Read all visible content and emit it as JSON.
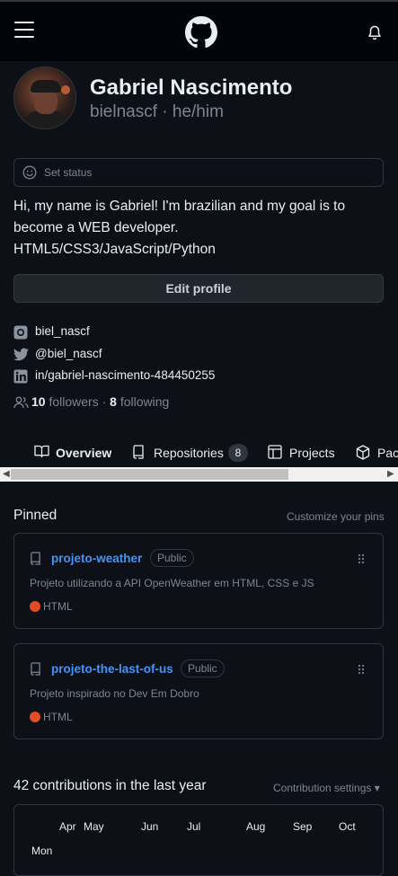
{
  "header": {
    "logo": "github-logo",
    "menu_icon": "hamburger-icon",
    "notification_icon": "bell-icon"
  },
  "profile": {
    "name": "Gabriel Nascimento",
    "username": "bielnascf",
    "pronouns": "he/him",
    "separator": " · ",
    "status_placeholder": "Set status",
    "bio": [
      "Hi, my name is Gabriel! I'm brazilian and my goal is to",
      "become a WEB developer.",
      "HTML5/CSS3/JavaScript/Python"
    ],
    "edit_label": "Edit profile",
    "socials": [
      {
        "icon": "instagram-icon",
        "label": "biel_nascf"
      },
      {
        "icon": "twitter-icon",
        "label": "@biel_nascf"
      },
      {
        "icon": "linkedin-icon",
        "label": "in/gabriel-nascimento-484450255"
      }
    ],
    "followers_count": "10",
    "followers_label": "followers",
    "following_count": "8",
    "following_label": "following",
    "dot": " · "
  },
  "tabs": [
    {
      "label": "Overview",
      "icon": "book-icon",
      "active": true
    },
    {
      "label": "Repositories",
      "icon": "repo-icon",
      "count": "8"
    },
    {
      "label": "Projects",
      "icon": "table-icon"
    },
    {
      "label": "Packages",
      "icon": "package-icon"
    }
  ],
  "pinned": {
    "title": "Pinned",
    "customize": "Customize your pins",
    "repos": [
      {
        "name": "projeto-weather",
        "visibility": "Public",
        "description": "Projeto utilizando a API OpenWeather em HTML, CSS e JS",
        "language": "HTML",
        "language_color": "#e34c26"
      },
      {
        "name": "projeto-the-last-of-us",
        "visibility": "Public",
        "description": "Projeto inspirado no Dev Em Dobro",
        "language": "HTML",
        "language_color": "#e34c26"
      }
    ]
  },
  "contributions": {
    "title": "42 contributions in the last year",
    "settings": "Contribution settings ▾",
    "months": [
      "Apr",
      "May",
      "Jun",
      "Jul",
      "Aug",
      "Sep",
      "Oct"
    ],
    "day_label": "Mon"
  },
  "colors": {
    "background": "#0d1117",
    "border": "#30363d",
    "link": "#4493f8",
    "muted": "#7d8590",
    "html_lang": "#e34c26"
  }
}
